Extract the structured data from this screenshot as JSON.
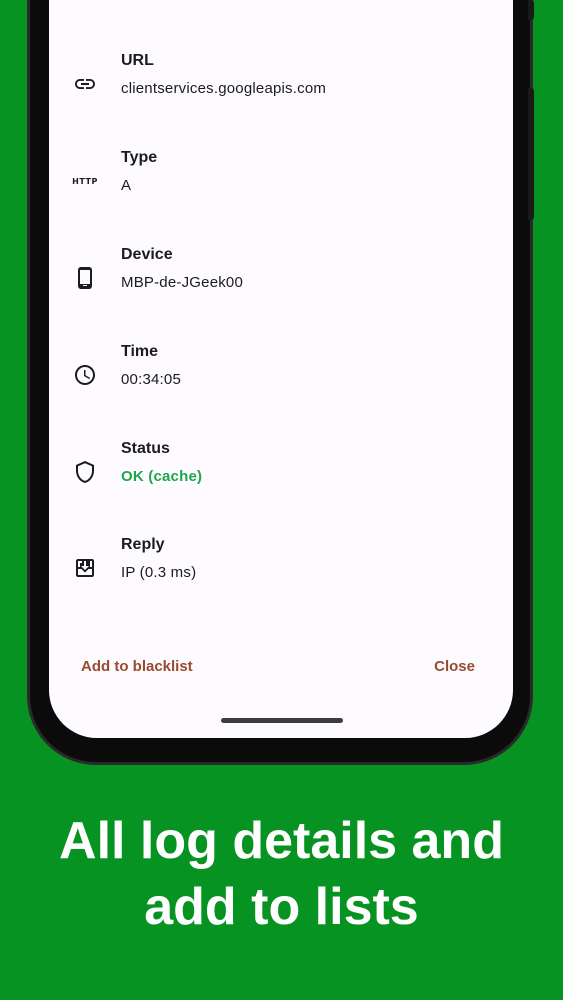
{
  "details": [
    {
      "label": "URL",
      "value": "clientservices.googleapis.com",
      "icon": "link-icon"
    },
    {
      "label": "Type",
      "value": "A",
      "icon": "http-icon"
    },
    {
      "label": "Device",
      "value": "MBP-de-JGeek00",
      "icon": "phone-icon"
    },
    {
      "label": "Time",
      "value": "00:34:05",
      "icon": "clock-icon"
    },
    {
      "label": "Status",
      "value": "OK (cache)",
      "icon": "shield-icon"
    },
    {
      "label": "Reply",
      "value": "IP (0.3 ms)",
      "icon": "download-icon"
    }
  ],
  "http_icon_text": "HTTP",
  "actions": {
    "blacklist": "Add to blacklist",
    "close": "Close"
  },
  "headline": {
    "line1": "All log details and",
    "line2": "add to lists"
  },
  "colors": {
    "background": "#079321",
    "status_ok": "#1fa64a",
    "action_text": "#9a4a2e"
  }
}
